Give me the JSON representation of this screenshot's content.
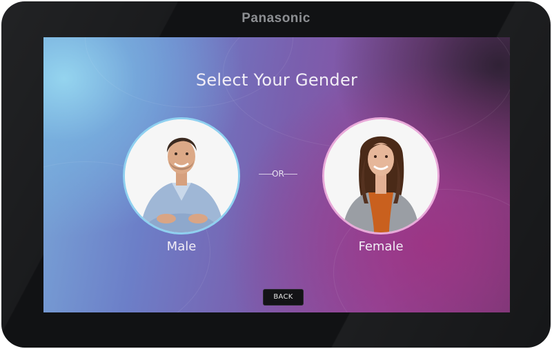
{
  "device": {
    "brand": "Panasonic"
  },
  "screen": {
    "title": "Select Your Gender",
    "separator": "OR",
    "options": [
      {
        "label": "Male",
        "avatar_icon": "male-portrait-icon",
        "ring_color": "#8fd0f0"
      },
      {
        "label": "Female",
        "avatar_icon": "female-portrait-icon",
        "ring_color": "#e9a9d9"
      }
    ],
    "back_label": "BACK"
  },
  "colors": {
    "bezel": "#111214",
    "screen_gradient_start": "#7aa8d8",
    "screen_gradient_end": "#8d4d9e",
    "back_button": "#131316"
  }
}
